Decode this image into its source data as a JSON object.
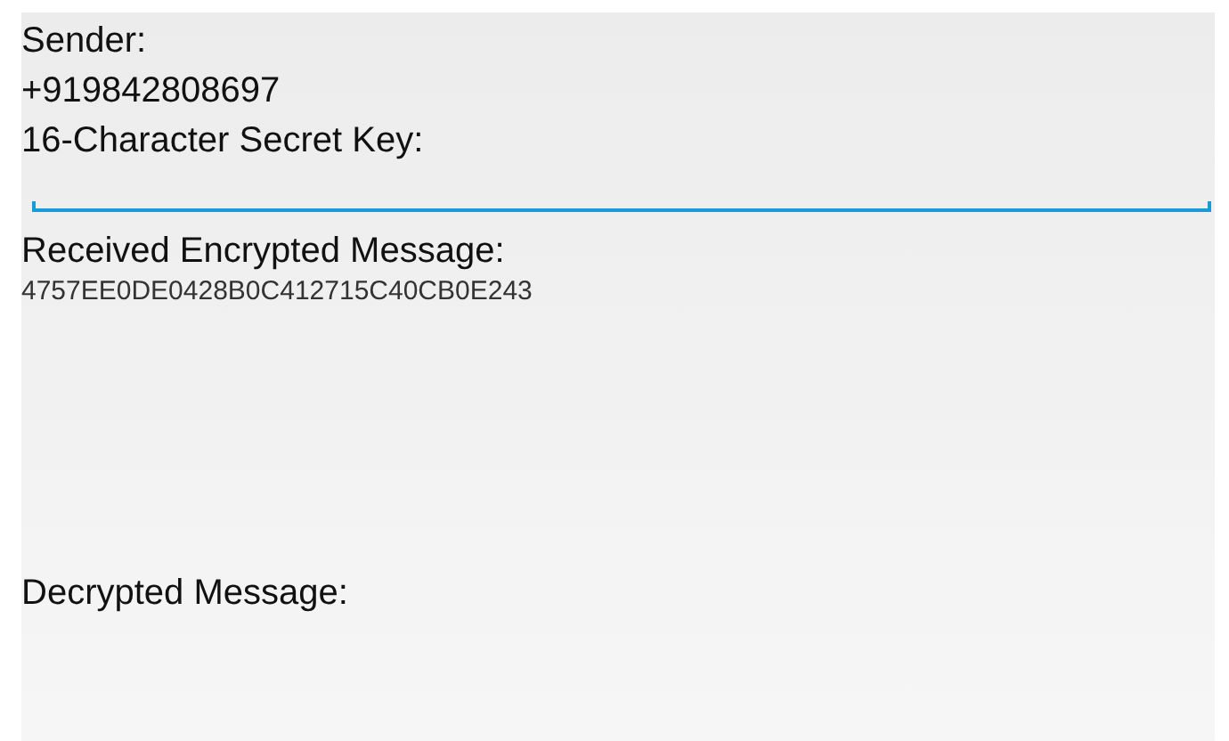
{
  "sender": {
    "label": "Sender:",
    "value": "+919842808697"
  },
  "secret_key": {
    "label": "16-Character Secret Key:",
    "focused": true
  },
  "encrypted": {
    "label": "Received Encrypted Message:",
    "value": "4757EE0DE0428B0C412715C40CB0E243"
  },
  "decrypted": {
    "label": "Decrypted Message:"
  }
}
